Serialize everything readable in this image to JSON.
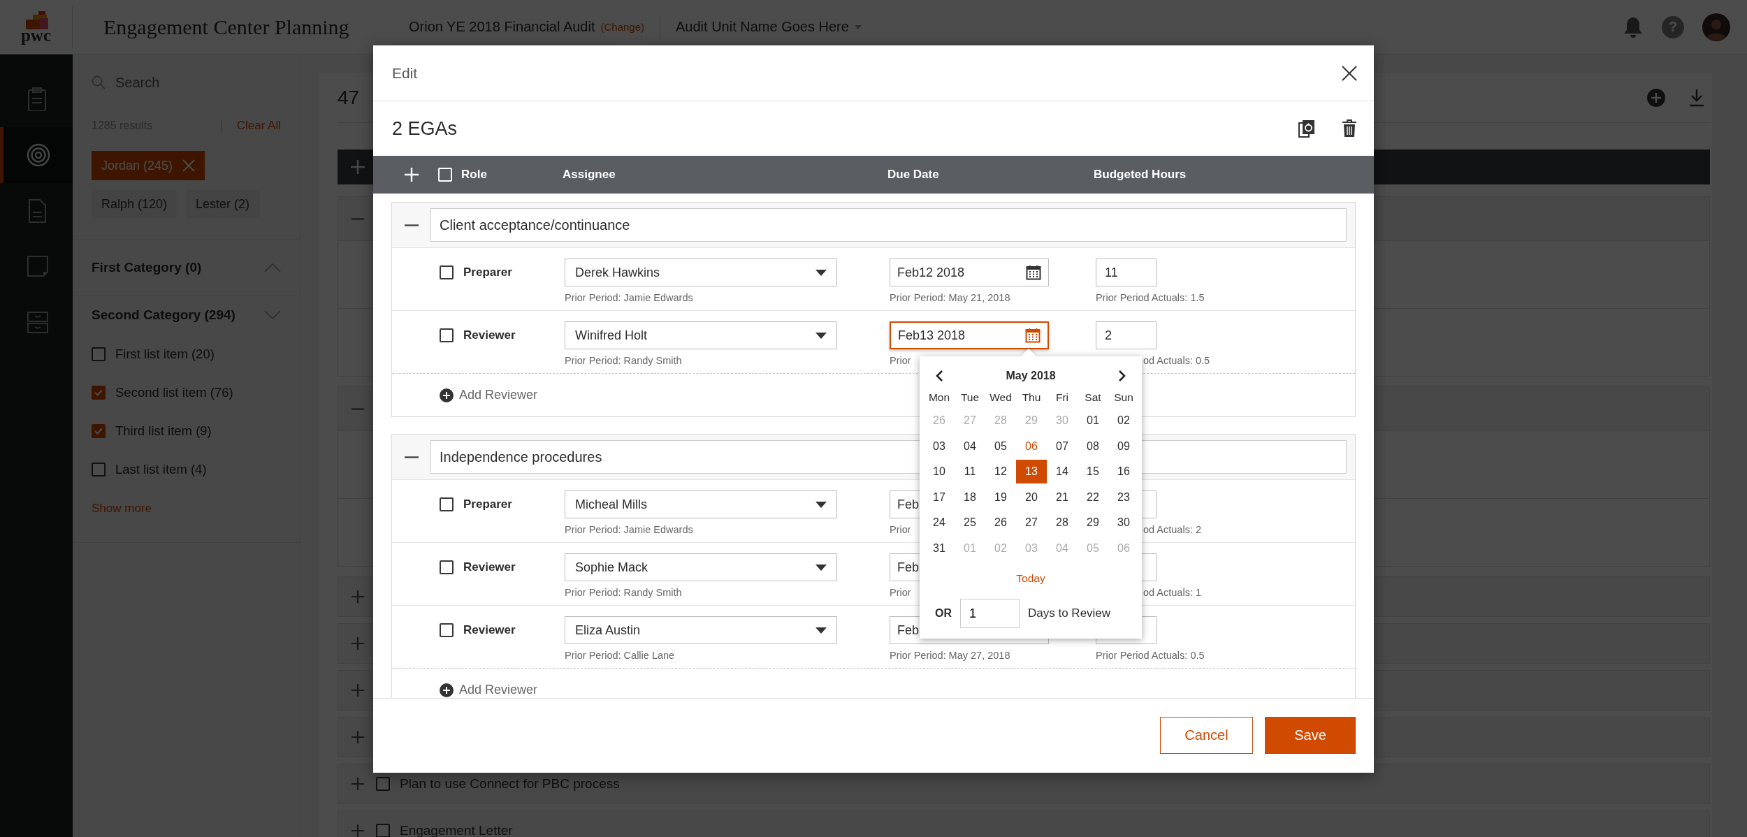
{
  "header": {
    "logo": "pwc",
    "app_title": "Engagement Center Planning",
    "engagement": "Orion YE 2018 Financial Audit",
    "change_link": "(Change)",
    "audit_unit": "Audit Unit Name Goes Here",
    "help": "?"
  },
  "nav": [
    {
      "selected": false
    },
    {
      "selected": true
    },
    {
      "selected": false
    },
    {
      "selected": false
    },
    {
      "selected": false
    }
  ],
  "filters": {
    "search_placeholder": "Search",
    "results": "1285 results",
    "clear_all": "Clear All",
    "chips": [
      {
        "label": "Jordan (245)",
        "selected": true
      },
      {
        "label": "Ralph (120)",
        "selected": false
      },
      {
        "label": "Lester (2)",
        "selected": false
      }
    ],
    "categories": [
      {
        "title": "First Category (0)",
        "expanded": true
      },
      {
        "title": "Second Category (294)",
        "expanded": false,
        "items": [
          {
            "label": "First list item (20)",
            "checked": false
          },
          {
            "label": "Second list item (76)",
            "checked": true
          },
          {
            "label": "Third list item (9)",
            "checked": true
          },
          {
            "label": "Last list item (4)",
            "checked": false
          }
        ]
      }
    ],
    "show_more": "Show more"
  },
  "list": {
    "title": "47",
    "rows": [
      {
        "expanded": true
      },
      {
        "expanded": true
      },
      {
        "expanded": false
      },
      {
        "expanded": false
      },
      {
        "expanded": false
      },
      {
        "expanded": false
      },
      {
        "expanded": false,
        "checked": false,
        "label": "Plan to use Connect for PBC process"
      },
      {
        "expanded": false,
        "checked": false,
        "label": "Engagement Letter"
      }
    ]
  },
  "modal": {
    "title": "Edit",
    "subtitle": "2 EGAs",
    "all_checked": false,
    "columns": [
      "Role",
      "Assignee",
      "Due Date",
      "Budgeted Hours"
    ],
    "groups": [
      {
        "title": "Client acceptance/continuance",
        "expanded": true,
        "add_label": "Add Reviewer",
        "rows": [
          {
            "role": "Preparer",
            "checked": false,
            "assignee": "Derek Hawkins",
            "assignee_prior": "Prior Period: Jamie Edwards",
            "due": "Feb12 2018",
            "due_prior": "Prior Period: May 21, 2018",
            "focused": false,
            "hours": "11",
            "hours_prior": "Prior Period Actuals: 1.5"
          },
          {
            "role": "Reviewer",
            "checked": false,
            "assignee": "Winifred Holt",
            "assignee_prior": "Prior Period: Randy Smith",
            "due": "Feb13 2018",
            "due_prior": "Prior",
            "focused": true,
            "hours": "2",
            "hours_prior": "od Actuals: 0.5"
          }
        ]
      },
      {
        "title": "Independence procedures",
        "expanded": true,
        "add_label": "Add Reviewer",
        "rows": [
          {
            "role": "Preparer",
            "checked": false,
            "assignee": "Micheal Mills",
            "assignee_prior": "Prior Period: Jamie Edwards",
            "due": "Feb",
            "due_prior": "Prior",
            "focused": false,
            "hours_prior": "od Actuals: 2"
          },
          {
            "role": "Reviewer",
            "checked": false,
            "assignee": "Sophie Mack",
            "assignee_prior": "Prior Period: Randy Smith",
            "due": "Feb",
            "due_prior": "Prior",
            "focused": false,
            "hours_prior": "od Actuals: 1"
          },
          {
            "role": "Reviewer",
            "checked": false,
            "assignee": "Eliza Austin",
            "assignee_prior": "Prior Period: Callie Lane",
            "due": "Feb",
            "due_prior": "Prior Period: May 27, 2018",
            "focused": false,
            "hours_prior": "Prior Period Actuals: 0.5"
          }
        ]
      }
    ],
    "date_picker": {
      "month": "May 2018",
      "weekdays": [
        "Mon",
        "Tue",
        "Wed",
        "Thu",
        "Fri",
        "Sat",
        "Sun"
      ],
      "weeks": [
        [
          {
            "label": "26",
            "muted": true,
            "today": false,
            "selected": false
          },
          {
            "label": "27",
            "muted": true,
            "today": false,
            "selected": false
          },
          {
            "label": "28",
            "muted": true,
            "today": false,
            "selected": false
          },
          {
            "label": "29",
            "muted": true,
            "today": false,
            "selected": false
          },
          {
            "label": "30",
            "muted": true,
            "today": false,
            "selected": false
          },
          {
            "label": "01",
            "muted": false,
            "today": false,
            "selected": false
          },
          {
            "label": "02",
            "muted": false,
            "today": false,
            "selected": false
          }
        ],
        [
          {
            "label": "03",
            "muted": false,
            "today": false,
            "selected": false
          },
          {
            "label": "04",
            "muted": false,
            "today": false,
            "selected": false
          },
          {
            "label": "05",
            "muted": false,
            "today": false,
            "selected": false
          },
          {
            "label": "06",
            "muted": false,
            "today": true,
            "selected": false
          },
          {
            "label": "07",
            "muted": false,
            "today": false,
            "selected": false
          },
          {
            "label": "08",
            "muted": false,
            "today": false,
            "selected": false
          },
          {
            "label": "09",
            "muted": false,
            "today": false,
            "selected": false
          }
        ],
        [
          {
            "label": "10",
            "muted": false,
            "today": false,
            "selected": false
          },
          {
            "label": "11",
            "muted": false,
            "today": false,
            "selected": false
          },
          {
            "label": "12",
            "muted": false,
            "today": false,
            "selected": false
          },
          {
            "label": "13",
            "muted": false,
            "today": false,
            "selected": true
          },
          {
            "label": "14",
            "muted": false,
            "today": false,
            "selected": false
          },
          {
            "label": "15",
            "muted": false,
            "today": false,
            "selected": false
          },
          {
            "label": "16",
            "muted": false,
            "today": false,
            "selected": false
          }
        ],
        [
          {
            "label": "17",
            "muted": false,
            "today": false,
            "selected": false
          },
          {
            "label": "18",
            "muted": false,
            "today": false,
            "selected": false
          },
          {
            "label": "19",
            "muted": false,
            "today": false,
            "selected": false
          },
          {
            "label": "20",
            "muted": false,
            "today": false,
            "selected": false
          },
          {
            "label": "21",
            "muted": false,
            "today": false,
            "selected": false
          },
          {
            "label": "22",
            "muted": false,
            "today": false,
            "selected": false
          },
          {
            "label": "23",
            "muted": false,
            "today": false,
            "selected": false
          }
        ],
        [
          {
            "label": "24",
            "muted": false,
            "today": false,
            "selected": false
          },
          {
            "label": "25",
            "muted": false,
            "today": false,
            "selected": false
          },
          {
            "label": "26",
            "muted": false,
            "today": false,
            "selected": false
          },
          {
            "label": "27",
            "muted": false,
            "today": false,
            "selected": false
          },
          {
            "label": "28",
            "muted": false,
            "today": false,
            "selected": false
          },
          {
            "label": "29",
            "muted": false,
            "today": false,
            "selected": false
          },
          {
            "label": "30",
            "muted": false,
            "today": false,
            "selected": false
          }
        ],
        [
          {
            "label": "31",
            "muted": false,
            "today": false,
            "selected": false
          },
          {
            "label": "01",
            "muted": true,
            "today": false,
            "selected": false
          },
          {
            "label": "02",
            "muted": true,
            "today": false,
            "selected": false
          },
          {
            "label": "03",
            "muted": true,
            "today": false,
            "selected": false
          },
          {
            "label": "04",
            "muted": true,
            "today": false,
            "selected": false
          },
          {
            "label": "05",
            "muted": true,
            "today": false,
            "selected": false
          },
          {
            "label": "06",
            "muted": true,
            "today": false,
            "selected": false
          }
        ]
      ],
      "today_link": "Today",
      "or_label": "OR",
      "days_value": "1",
      "days_label": "Days to Review"
    },
    "cancel": "Cancel",
    "save": "Save"
  }
}
